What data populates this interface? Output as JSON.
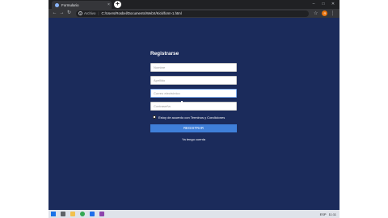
{
  "browser": {
    "tab_title": "Formulario",
    "tab_close": "×",
    "new_tab": "+",
    "window_controls": [
      "–",
      "□",
      "✕"
    ],
    "nav": {
      "back": "←",
      "forward": "→",
      "reload": "↻"
    },
    "address": {
      "scheme": "Archivo",
      "separator": "|",
      "url": "C:/Users/Rosbel/Documents/WebX/Kick/form-1.html"
    },
    "icons": {
      "info": "info-icon",
      "star": "star-icon",
      "avatar": "avatar",
      "menu": "menu-icon"
    },
    "colors": {
      "tabstrip": "#202124",
      "toolbar": "#35363a",
      "avatar": "#e8710a"
    }
  },
  "page": {
    "background": "#1b2b5b",
    "form": {
      "title": "Registrarse",
      "fields": {
        "first_name_placeholder": "Nombre",
        "last_name_placeholder": "Apellido",
        "email_placeholder": "Correo electrónico",
        "password_placeholder": "Contraseña"
      },
      "terms_text": "Estoy de acuerdo con Terminos y Condiciones",
      "register_button": "REGISTRAR",
      "account_link": "Ya tengo cuenta"
    },
    "colors": {
      "button": "#3f7fd9",
      "field_focus": "#7aa7e8"
    }
  },
  "taskbar": {
    "tray_time": "11:11",
    "tray_lang": "ESP",
    "colors": {
      "taskbar": "#dfe3ea",
      "start": "#1a73e8"
    }
  }
}
